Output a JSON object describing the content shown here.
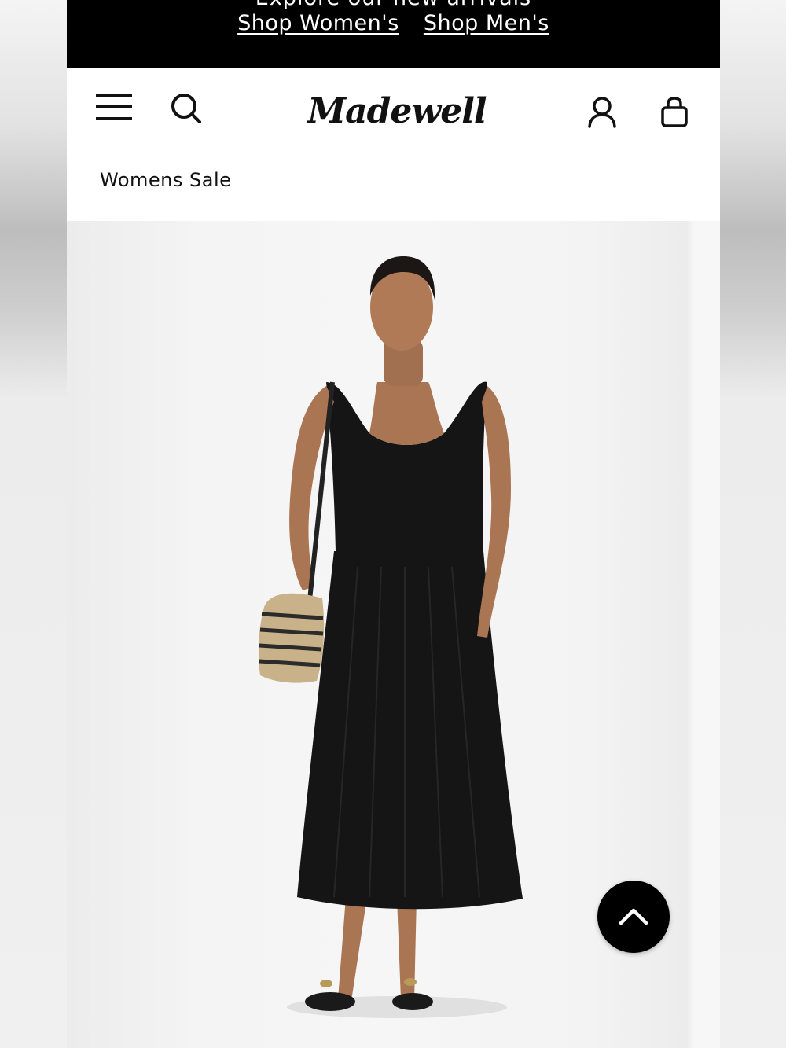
{
  "promo": {
    "headline": "Explore our new arrivals",
    "shop_women_label": "Shop Women's",
    "shop_men_label": "Shop Men's"
  },
  "header": {
    "logo_text": "Madewell",
    "icons": [
      "menu-icon",
      "search-icon",
      "account-icon",
      "bag-icon"
    ]
  },
  "breadcrumb": {
    "label": "Womens Sale"
  },
  "product": {
    "image_description_icon": "product-photo",
    "dress_color": "#111111"
  },
  "back_to_top": {
    "icon": "chevron-up-icon"
  }
}
